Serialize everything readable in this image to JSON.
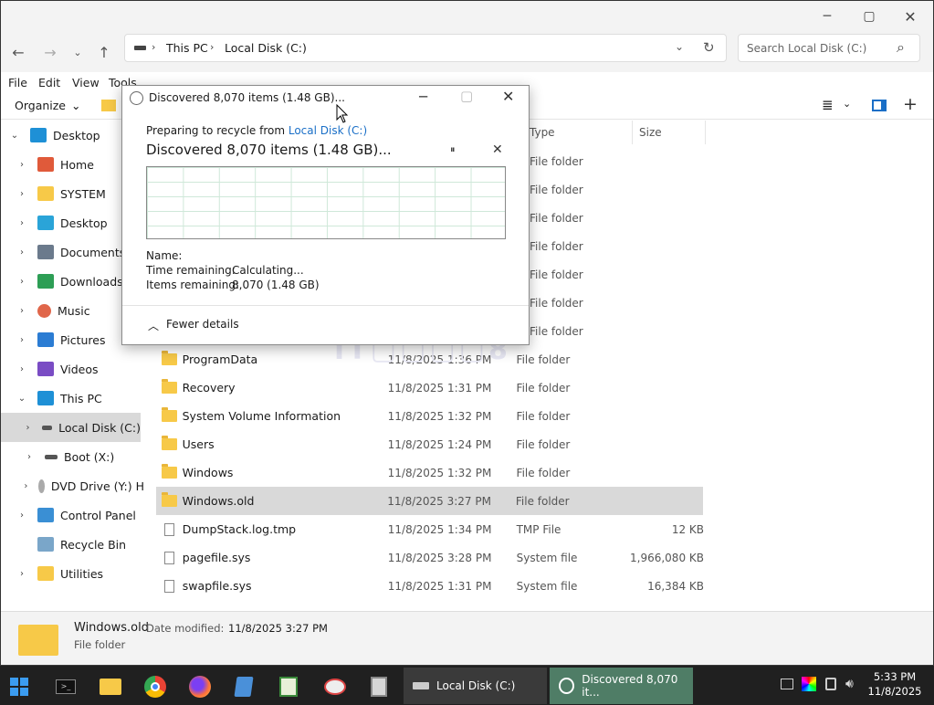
{
  "window": {
    "minimize": "─",
    "maximize": "▢",
    "close": "✕"
  },
  "address": {
    "crumbs": [
      "This PC",
      "Local Disk (C:)"
    ],
    "search_placeholder": "Search Local Disk (C:)"
  },
  "menu": [
    "File",
    "Edit",
    "View",
    "Tools"
  ],
  "toolbar": {
    "organize": "Organize",
    "organize_caret": "⌄"
  },
  "sidebar": [
    {
      "label": "Desktop",
      "icon": "desktop-blue-icon",
      "expanded": true,
      "indent": 0,
      "color": "#1e90d6"
    },
    {
      "label": "Home",
      "icon": "home-icon",
      "indent": 1,
      "color": "#e05a3a"
    },
    {
      "label": "SYSTEM",
      "icon": "folder-icon",
      "indent": 1,
      "color": "#f7c948"
    },
    {
      "label": "Desktop",
      "icon": "desktop-icon",
      "indent": 1,
      "color": "#2aa4d8"
    },
    {
      "label": "Documents",
      "icon": "documents-icon",
      "indent": 1,
      "color": "#6b7a8c"
    },
    {
      "label": "Downloads",
      "icon": "download-icon",
      "indent": 1,
      "color": "#2d9e55"
    },
    {
      "label": "Music",
      "icon": "music-icon",
      "indent": 1,
      "color": "#e0664a"
    },
    {
      "label": "Pictures",
      "icon": "pictures-icon",
      "indent": 1,
      "color": "#2b7cd3"
    },
    {
      "label": "Videos",
      "icon": "videos-icon",
      "indent": 1,
      "color": "#7a4cc4"
    },
    {
      "label": "This PC",
      "icon": "this-pc-icon",
      "expanded": true,
      "indent": 1,
      "color": "#1e90d6"
    },
    {
      "label": "Local Disk (C:)",
      "icon": "drive-icon",
      "indent": 2,
      "color": "#555555",
      "selected": true
    },
    {
      "label": "Boot (X:)",
      "icon": "drive-icon",
      "indent": 2,
      "color": "#555555"
    },
    {
      "label": "DVD Drive (Y:) H",
      "icon": "dvd-icon",
      "indent": 2,
      "color": "#aaaaaa"
    },
    {
      "label": "Control Panel",
      "icon": "control-panel-icon",
      "indent": 1,
      "color": "#3a8fd4"
    },
    {
      "label": "Recycle Bin",
      "icon": "recycle-bin-icon",
      "indent": 1,
      "color": "#7aa6c9",
      "nochev": true
    },
    {
      "label": "Utilities",
      "icon": "folder-icon",
      "indent": 1,
      "color": "#f7c948"
    }
  ],
  "columns": {
    "type": "Type",
    "size": "Size"
  },
  "files_hidden": [
    "File folder",
    "File folder",
    "File folder",
    "File folder",
    "File folder",
    "File folder",
    "File folder"
  ],
  "files": [
    {
      "name": "ProgramData",
      "date": "11/8/2025 1:36 PM",
      "type": "File folder",
      "size": "",
      "kind": "folder"
    },
    {
      "name": "Recovery",
      "date": "11/8/2025 1:31 PM",
      "type": "File folder",
      "size": "",
      "kind": "folder"
    },
    {
      "name": "System Volume Information",
      "date": "11/8/2025 1:32 PM",
      "type": "File folder",
      "size": "",
      "kind": "folder"
    },
    {
      "name": "Users",
      "date": "11/8/2025 1:24 PM",
      "type": "File folder",
      "size": "",
      "kind": "folder"
    },
    {
      "name": "Windows",
      "date": "11/8/2025 1:32 PM",
      "type": "File folder",
      "size": "",
      "kind": "folder"
    },
    {
      "name": "Windows.old",
      "date": "11/8/2025 3:27 PM",
      "type": "File folder",
      "size": "",
      "kind": "folder",
      "selected": true
    },
    {
      "name": "DumpStack.log.tmp",
      "date": "11/8/2025 1:34 PM",
      "type": "TMP File",
      "size": "12 KB",
      "kind": "file"
    },
    {
      "name": "pagefile.sys",
      "date": "11/8/2025 3:28 PM",
      "type": "System file",
      "size": "1,966,080 KB",
      "kind": "file"
    },
    {
      "name": "swapfile.sys",
      "date": "11/8/2025 1:31 PM",
      "type": "System file",
      "size": "16,384 KB",
      "kind": "file"
    }
  ],
  "details": {
    "name": "Windows.old",
    "date_label": "Date modified:",
    "date_value": "11/8/2025 3:27 PM",
    "type": "File folder"
  },
  "dialog": {
    "title": "Discovered 8,070 items (1.48 GB)...",
    "preparing_prefix": "Preparing to recycle from",
    "preparing_link": "Local Disk (C:)",
    "heading": "Discovered 8,070 items (1.48 GB)...",
    "pause": "⏸",
    "cancel": "✕",
    "name_label": "Name:",
    "time_label": "Time remaining:",
    "time_value": "Calculating...",
    "items_label": "Items remaining:",
    "items_value": "8,070 (1.48 GB)",
    "fewer_details": "Fewer details"
  },
  "taskbar": {
    "items": [
      {
        "label": "Local Disk (C:)"
      },
      {
        "label": "Discovered 8,070 it..."
      }
    ],
    "time": "5:33 PM",
    "date": "11/8/2025"
  },
  "colors": {
    "accent": "#1a6fc7",
    "selection": "#cccccc",
    "taskbar": "#202020",
    "taskbar_active": "#3c6e55"
  }
}
